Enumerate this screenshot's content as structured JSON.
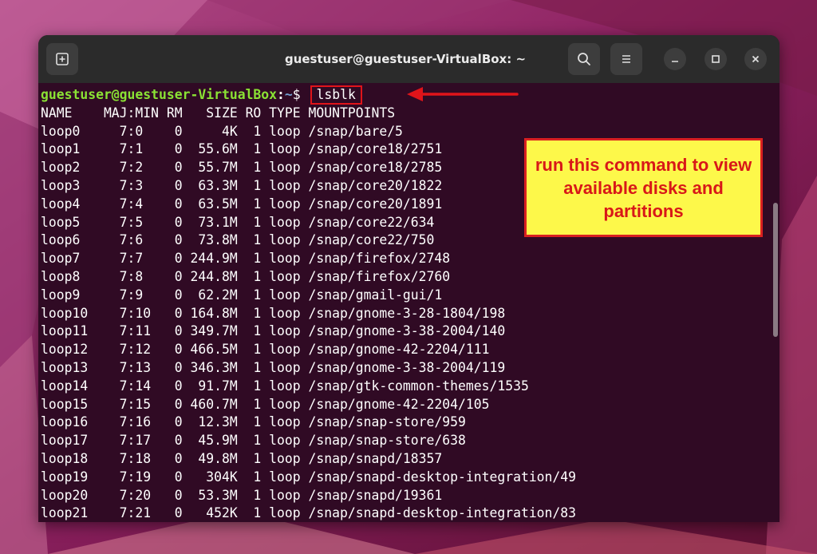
{
  "window": {
    "title": "guestuser@guestuser-VirtualBox: ~"
  },
  "prompt": {
    "user_host": "guestuser@guestuser-VirtualBox",
    "separator": ":",
    "path": "~",
    "symbol": "$ ",
    "command": "lsblk"
  },
  "output_lines": [
    "NAME    MAJ:MIN RM   SIZE RO TYPE MOUNTPOINTS",
    "loop0     7:0    0     4K  1 loop /snap/bare/5",
    "loop1     7:1    0  55.6M  1 loop /snap/core18/2751",
    "loop2     7:2    0  55.7M  1 loop /snap/core18/2785",
    "loop3     7:3    0  63.3M  1 loop /snap/core20/1822",
    "loop4     7:4    0  63.5M  1 loop /snap/core20/1891",
    "loop5     7:5    0  73.1M  1 loop /snap/core22/634",
    "loop6     7:6    0  73.8M  1 loop /snap/core22/750",
    "loop7     7:7    0 244.9M  1 loop /snap/firefox/2748",
    "loop8     7:8    0 244.8M  1 loop /snap/firefox/2760",
    "loop9     7:9    0  62.2M  1 loop /snap/gmail-gui/1",
    "loop10    7:10   0 164.8M  1 loop /snap/gnome-3-28-1804/198",
    "loop11    7:11   0 349.7M  1 loop /snap/gnome-3-38-2004/140",
    "loop12    7:12   0 466.5M  1 loop /snap/gnome-42-2204/111",
    "loop13    7:13   0 346.3M  1 loop /snap/gnome-3-38-2004/119",
    "loop14    7:14   0  91.7M  1 loop /snap/gtk-common-themes/1535",
    "loop15    7:15   0 460.7M  1 loop /snap/gnome-42-2204/105",
    "loop16    7:16   0  12.3M  1 loop /snap/snap-store/959",
    "loop17    7:17   0  45.9M  1 loop /snap/snap-store/638",
    "loop18    7:18   0  49.8M  1 loop /snap/snapd/18357",
    "loop19    7:19   0   304K  1 loop /snap/snapd-desktop-integration/49",
    "loop20    7:20   0  53.3M  1 loop /snap/snapd/19361",
    "loop21    7:21   0   452K  1 loop /snap/snapd-desktop-integration/83"
  ],
  "annotation": {
    "text": "run this command to view available disks and partitions"
  },
  "icons": {
    "new_tab": "new-tab-icon",
    "search": "search-icon",
    "menu": "hamburger-menu-icon",
    "minimize": "minimize-icon",
    "maximize": "maximize-icon",
    "close": "close-icon",
    "arrow": "arrow-left-icon"
  },
  "colors": {
    "terminal_bg": "#300a24",
    "titlebar_bg": "#2b2b2b",
    "prompt_user": "#8ae234",
    "prompt_path": "#729fcf",
    "highlight_red": "#e0141a",
    "callout_bg": "#fdf84a",
    "callout_text": "#d81818"
  }
}
